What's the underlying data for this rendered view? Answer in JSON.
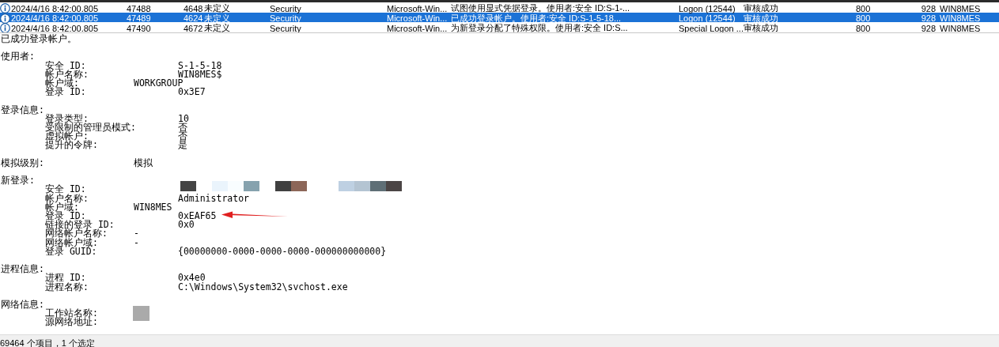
{
  "table": {
    "rows": [
      {
        "selected": false,
        "cells": [
          "2024/4/16 8:42:00.805",
          "47488",
          "4648",
          "未定义",
          "Security",
          "Microsoft-Win...",
          "试图使用显式凭据登录。使用者:安全 ID:S-1-...",
          "Logon (12544)",
          "审核成功",
          "800",
          "928",
          "WIN8MES"
        ]
      },
      {
        "selected": true,
        "cells": [
          "2024/4/16 8:42:00.805",
          "47489",
          "4624",
          "未定义",
          "Security",
          "Microsoft-Win...",
          "已成功登录帐户。使用者:安全 ID:S-1-5-18...",
          "Logon (12544)",
          "审核成功",
          "800",
          "928",
          "WIN8MES"
        ]
      },
      {
        "selected": false,
        "cells": [
          "2024/4/16 8:42:00.805",
          "47490",
          "4672",
          "未定义",
          "Security",
          "Microsoft-Win...",
          "为新登录分配了特殊权限。使用者:安全 ID:S...",
          "Special Logon ...",
          "审核成功",
          "800",
          "928",
          "WIN8MES"
        ]
      }
    ]
  },
  "details": {
    "summary": "已成功登录帐户。",
    "sections": [
      {
        "heading": "使用者:",
        "lines": [
          "\t安全 ID:\t\t\tS-1-5-18",
          "\t帐户名称:\t\tWIN8MES$",
          "\t帐户域:\t\tWORKGROUP",
          "\t登录 ID:\t\t\t0x3E7"
        ]
      },
      {
        "heading": "登录信息:",
        "lines": [
          "\t登录类型:\t\t10",
          "\t受限制的管理员模式:\t否",
          "\t虚拟帐户:\t\t否",
          "\t提升的令牌:\t\t是"
        ]
      },
      {
        "heading": "模拟级别:\t\t模拟"
      },
      {
        "heading": "新登录:",
        "lines": [
          {
            "text": "\t安全 ID:",
            "kind": "mosaic"
          },
          "\t帐户名称:\t\tAdministrator",
          "\t帐户域:\t\tWIN8MES",
          {
            "text": "\t登录 ID:\t\t\t0xEAF65",
            "kind": "marked"
          },
          "\t链接的登录 ID:\t\t0x0",
          "\t网络帐户名称:\t-",
          "\t网络帐户域:\t-",
          "\t登录 GUID:\t\t{00000000-0000-0000-0000-000000000000}"
        ]
      },
      {
        "heading": "进程信息:",
        "lines": [
          "\t进程 ID:\t\t\t0x4e0",
          "\t进程名称:\t\tC:\\Windows\\System32\\svchost.exe"
        ]
      },
      {
        "heading": "网络信息:",
        "lines": [
          {
            "text": "\t工作站名称:",
            "kind": "blocked"
          },
          "\t源网络地址:"
        ]
      }
    ]
  },
  "status_bar": "69464 个项目，1 个选定"
}
